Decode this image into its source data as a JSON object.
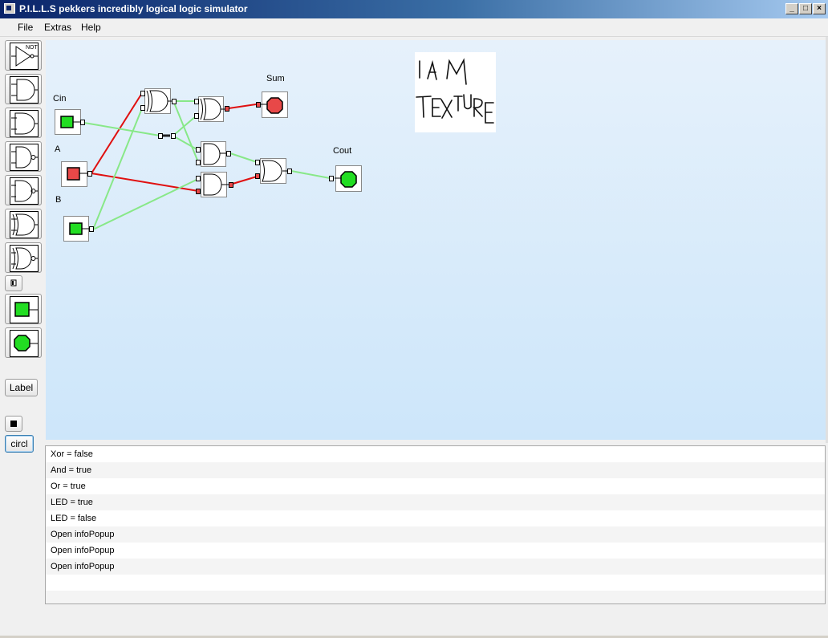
{
  "window": {
    "title": "P.I.L.L.S pekkers incredibly logical logic simulator",
    "minimize": "_",
    "maximize": "□",
    "close": "×"
  },
  "menu": [
    "File",
    "Extras",
    "Help"
  ],
  "toolbox": {
    "not_label": "NOT",
    "label_button": "Label",
    "circle_button": "circl"
  },
  "canvas": {
    "labels": {
      "sum": "Sum",
      "cin": "Cin",
      "a": "A",
      "b": "B",
      "cout": "Cout"
    },
    "texture_text": "I AM TEXTURE",
    "input_states": {
      "cin": "on",
      "a": "off",
      "b": "on"
    },
    "output_states": {
      "sum": "off",
      "cout": "on"
    },
    "colors": {
      "on": "#22dd22",
      "off": "#e84848",
      "wire_on": "#88e888",
      "wire_off": "#e01010"
    }
  },
  "log": [
    "Xor = false",
    "And = true",
    "Or = true",
    "LED = true",
    "LED = false",
    "Open infoPopup",
    "Open infoPopup",
    "Open infoPopup",
    "",
    ""
  ]
}
